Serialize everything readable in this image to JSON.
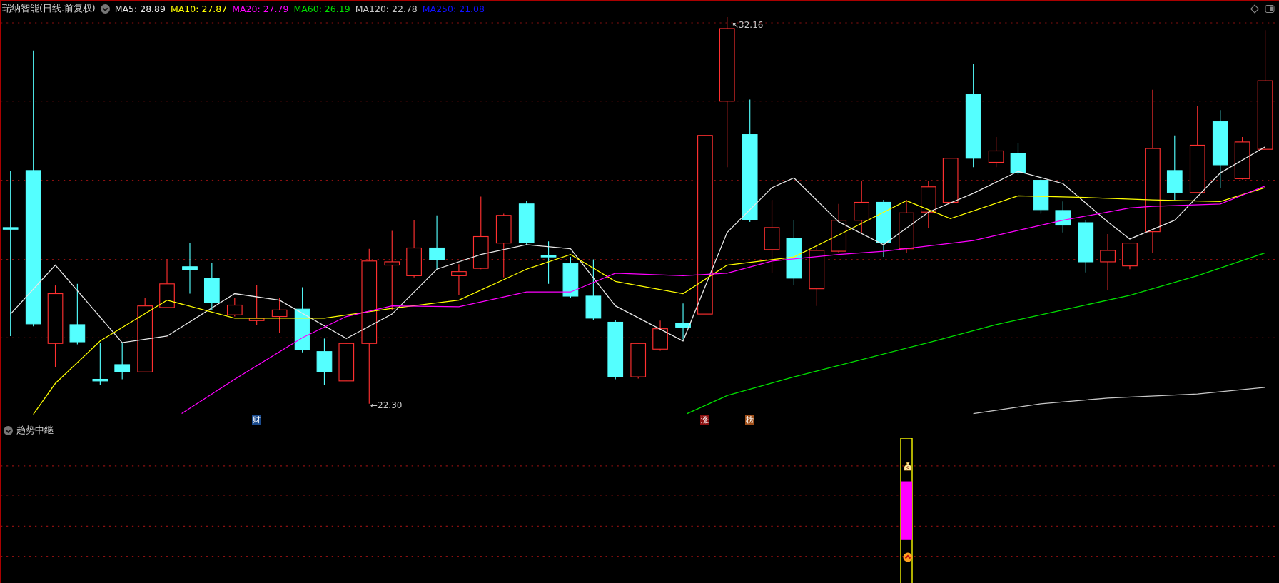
{
  "chart_header": {
    "title": "瑞纳智能(日线.前复权)",
    "moving_averages": [
      {
        "label": "MA5: 28.89",
        "color": "#e8e8e8"
      },
      {
        "label": "MA10: 27.87",
        "color": "#ffff00"
      },
      {
        "label": "MA20: 27.79",
        "color": "#ff00ff"
      },
      {
        "label": "MA60: 26.19",
        "color": "#00e000"
      },
      {
        "label": "MA120: 22.78",
        "color": "#c8c8c8"
      },
      {
        "label": "MA250: 21.08",
        "color": "#1010ff"
      }
    ]
  },
  "price_labels": [
    {
      "text": "↖32.16"
    },
    {
      "text": "←22.30"
    }
  ],
  "event_markers": [
    {
      "text": "财",
      "color": "#1a4a8c"
    },
    {
      "text": "涨",
      "color": "#8c1010"
    },
    {
      "text": "榜",
      "color": "#a0501a"
    }
  ],
  "indicator_panel": {
    "title": "趋势中继"
  }
}
